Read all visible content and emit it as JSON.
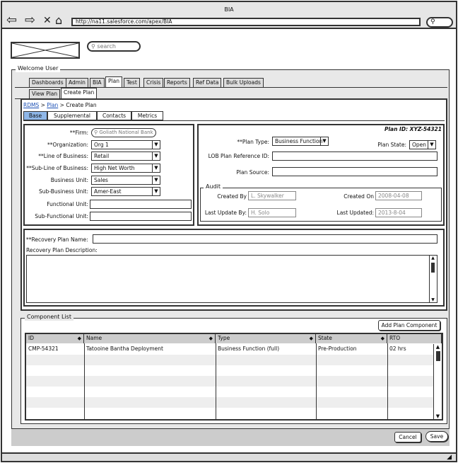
{
  "window": {
    "title": "BIA",
    "url": "http://na11.salesforce.com/apex/BIA"
  },
  "header": {
    "search_placeholder": "search",
    "welcome": "Welcome User"
  },
  "tabs": [
    "Dashboards",
    "Admin",
    "BIA",
    "Plan",
    "Test",
    "Crisis",
    "Reports",
    "Ref Data",
    "Bulk Uploads"
  ],
  "active_tab": "Plan",
  "subtabs": [
    "View Plan",
    "Create Plan"
  ],
  "breadcrumb": {
    "root": "RDMS",
    "section": "Plan",
    "current": "Create Plan",
    "sep": ">"
  },
  "section_tabs": [
    "Base",
    "Supplemental",
    "Contacts",
    "Metrics"
  ],
  "left_form": {
    "firm_label": "**Firm:",
    "firm_value": "Goliath National Bank",
    "org_label": "**Organization:",
    "org_value": "Org 1",
    "lob_label": "**Line of Business:",
    "lob_value": "Retail",
    "sublob_label": "**Sub-Line of Business:",
    "sublob_value": "High Net Worth",
    "bu_label": "Business Unit:",
    "bu_value": "Sales",
    "sbu_label": "Sub-Business Unit:",
    "sbu_value": "Amer-East",
    "fu_label": "Functional Unit:",
    "fu_value": "",
    "sfu_label": "Sub-Functional Unit:",
    "sfu_value": ""
  },
  "right_form": {
    "plan_id": "Plan ID: XYZ-54321",
    "plan_type_label": "**Plan Type:",
    "plan_type_value": "Business Function",
    "plan_state_label": "Plan State:",
    "plan_state_value": "Open",
    "lob_ref_label": "LOB Plan Reference ID:",
    "lob_ref_value": "",
    "source_label": "Plan Source:",
    "source_value": ""
  },
  "audit": {
    "legend": "Audit",
    "created_by_label": "Created By",
    "created_by": "L. Skywalker",
    "created_on_label": "Created On",
    "created_on": "2008-04-08",
    "updated_by_label": "Last Update By:",
    "updated_by": "H. Solo",
    "updated_label": "Last Updated:",
    "updated": "2013-8-04"
  },
  "recovery": {
    "name_label": "**Recovery Plan Name:",
    "name_value": "",
    "desc_label": "Recovery Plan Description:",
    "desc_value": ""
  },
  "components": {
    "legend": "Component List",
    "add_button": "Add Plan Component",
    "columns": [
      "ID",
      "Name",
      "Type",
      "State",
      "RTO"
    ],
    "rows": [
      [
        "CMP-54321",
        "Tatooine Bantha Deployment",
        "Business Function (full)",
        "Pre-Production",
        "02 hrs"
      ]
    ]
  },
  "footer": {
    "cancel": "Cancel",
    "save": "Save"
  }
}
